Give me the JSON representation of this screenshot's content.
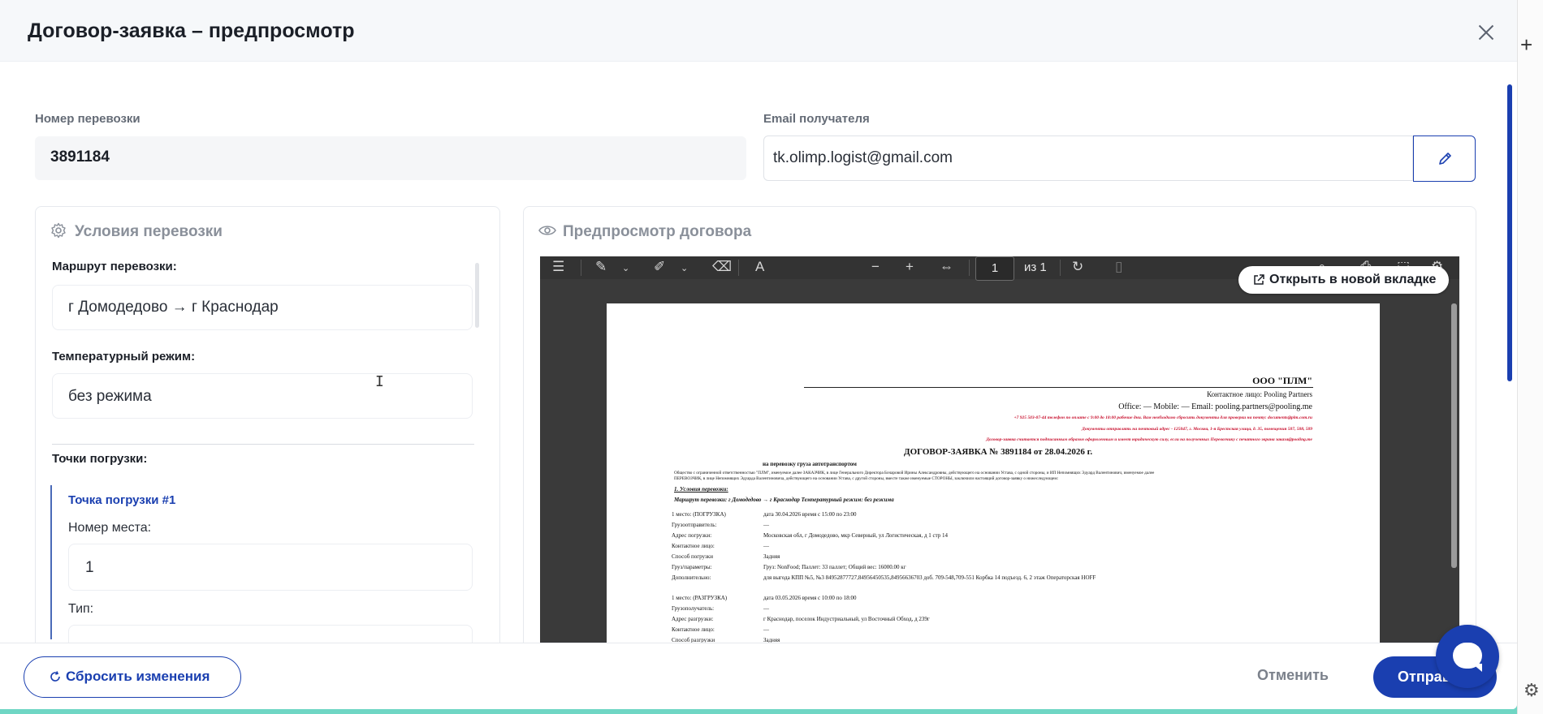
{
  "modal": {
    "title": "Договор-заявка – предпросмотр"
  },
  "fields": {
    "shipment_number_label": "Номер перевозки",
    "shipment_number_value": "3891184",
    "email_label": "Email получателя",
    "email_value": "tk.olimp.logist@gmail.com"
  },
  "conditions": {
    "title": "Условия перевозки",
    "route_label": "Маршрут перевозки:",
    "route_value": "г Домодедово → г Краснодар",
    "temp_label": "Температурный режим:",
    "temp_value": "без режима",
    "loading_points_label": "Точки погрузки:",
    "point_title": "Точка погрузки #1",
    "place_number_label": "Номер места:",
    "place_number_value": "1",
    "type_label": "Тип:"
  },
  "preview": {
    "title": "Предпросмотр договора",
    "page_current": "1",
    "page_total": "из 1",
    "open_new_tab": "Открыть в новой вкладке"
  },
  "pdf": {
    "company": "ООО \"ПЛМ\"",
    "contact": "Контактное лицо: Pooling Partners",
    "office": "Office: —  Mobile: —  Email: pooling.partners@pooling.me",
    "red1": "+7 925 503-07-44 телефон по оплате с 9:00 до 18:00 рабочие дни. Вам необходимо сбросить документы для проверки  на почту: documents@plm.com.ru",
    "red2": "Документы отправлять на почтовый адрес - 125047, г. Москва, 1-я Брестская улица, д. 35, помещения 507, 508, 509",
    "red3": "Договор-заявка считается подписанным образом оформленным и имеет юридическую силу, если на полученных Перевозчику с печатного экрана заказа@pooling.me",
    "doc_title": "ДОГОВОР-ЗАЯВКА № 3891184 от 28.04.2026 г.",
    "doc_subtitle": "на перевозку груза автотранспортом",
    "intro1": "Общество с ограниченной ответственностью \"ПЛМ\", именуемое далее ЗАКАЗЧИК, в лице Генерального Директора Бочаровой Ирины Александровны, действующего на основании Устава, с одной стороны, и ИП Непомнящих Эдуард Валентинович, именуемое далее",
    "intro2": "ПЕРЕВОЗЧИК, в лице Непомнящих Эдуарда Валентиновича, действующего на основании Устава, с другой стороны, вместе также именуемые СТОРОНЫ, заключили настоящий договор-заявку о нижеследующем:",
    "section1": "1. Условия перевозки:",
    "route_line": "Маршрут перевозки: г Домодедово  →  г Краснодар   Температурный режим: без режима",
    "rows": [
      {
        "k": "1 место: (ПОГРУЗКА)",
        "v": "дата 30.04.2026 время с 15:00 по 23:00"
      },
      {
        "k": "Грузоотправитель:",
        "v": "—"
      },
      {
        "k": "Адрес погрузки:",
        "v": "Московская обл, г Домодедово, мкр Северный, ул Логистическая, д 1 стр 14"
      },
      {
        "k": "Контактное лицо:",
        "v": "—"
      },
      {
        "k": "Способ погрузки",
        "v": "Задняя"
      },
      {
        "k": "Груз/параметры:",
        "v": "Груз: NonFood; Паллет: 33 паллет; Общий вес: 16000.00 кг"
      },
      {
        "k": "Дополнительно:",
        "v": "для выгода КПП №5, №3 84952877727,84956450535,84956636703  доб. 709-548,709-551 Корбка 14 подъезд. 6, 2 этаж Операторская HOFF"
      }
    ],
    "rows2": [
      {
        "k": "1 место: (РАЗГРУЗКА)",
        "v": "дата 03.05.2026 время с 10:00 по 18:00"
      },
      {
        "k": "Грузополучатель:",
        "v": "—"
      },
      {
        "k": "Адрес разгрузки:",
        "v": "г Краснодар, поселок Индустриальный, ул Восточный Обход, д 239г"
      },
      {
        "k": "Контактное лицо:",
        "v": "—"
      },
      {
        "k": "Способ разгрузки",
        "v": "Задняя"
      }
    ]
  },
  "footer": {
    "reset": "Сбросить изменения",
    "cancel": "Отменить",
    "send": "Отправить"
  },
  "colors": {
    "accent": "#1a3fb0",
    "backdrop": "#6fd6c4",
    "viewer_bg": "#3a3a3a"
  }
}
